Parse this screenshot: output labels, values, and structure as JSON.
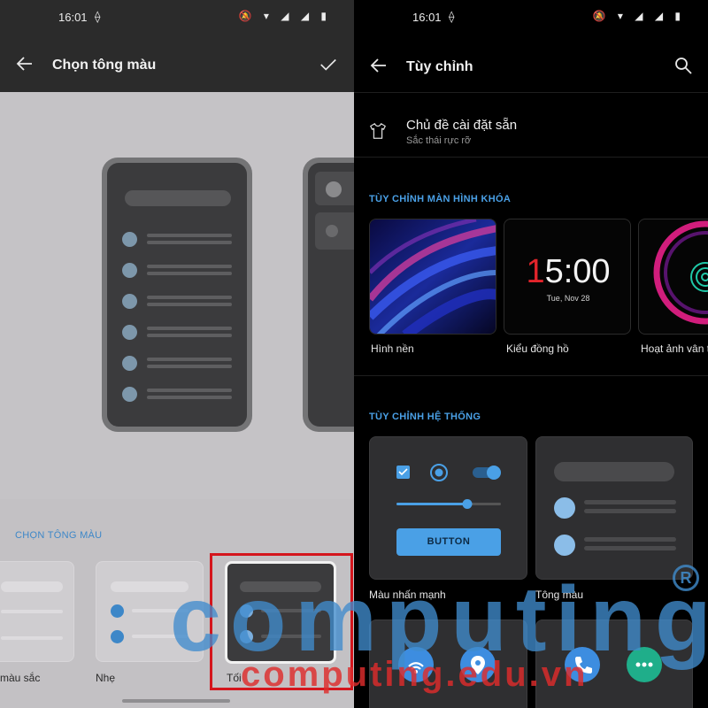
{
  "left": {
    "statusbar": {
      "time": "16:01",
      "extra": "⟠",
      "icons": "🔕 ▾ ◢ ◢ ▮"
    },
    "topbar": {
      "title": "Chọn tông màu"
    },
    "choose_section": {
      "label": "CHỌN TÔNG MÀU",
      "swatches": [
        {
          "name": "màu sắc",
          "selected": false
        },
        {
          "name": "Nhẹ",
          "selected": false
        },
        {
          "name": "Tối",
          "selected": true
        }
      ]
    }
  },
  "right": {
    "statusbar": {
      "time": "16:01",
      "extra": "⟠",
      "icons": "🔕 ▾ ◢ ◢ ▮"
    },
    "header": {
      "title": "Tùy chỉnh"
    },
    "preset": {
      "title": "Chủ đề cài đặt sẵn",
      "subtitle": "Sắc thái rực rỡ"
    },
    "lock_section": {
      "heading": "TÙY CHỈNH MÀN HÌNH KHÓA",
      "cards": [
        {
          "label": "Hình nền"
        },
        {
          "label": "Kiểu đồng hồ",
          "clock_hour_first_digit": "1",
          "clock_rest": "5:00",
          "clock_date": "Tue, Nov 28"
        },
        {
          "label": "Hoạt ảnh vân t"
        }
      ]
    },
    "system_section": {
      "heading": "TÙY CHỈNH HỆ THỐNG",
      "cards": [
        {
          "label": "Màu nhấn mạnh",
          "button_label": "BUTTON"
        },
        {
          "label": "Tông màu"
        }
      ]
    }
  },
  "watermark": {
    "big": "computing",
    "small": "computing.edu.vn",
    "mark": "R"
  },
  "colors": {
    "accent": "#4aa0e6",
    "selection": "#d4161d",
    "clock_red": "#e3242b"
  }
}
